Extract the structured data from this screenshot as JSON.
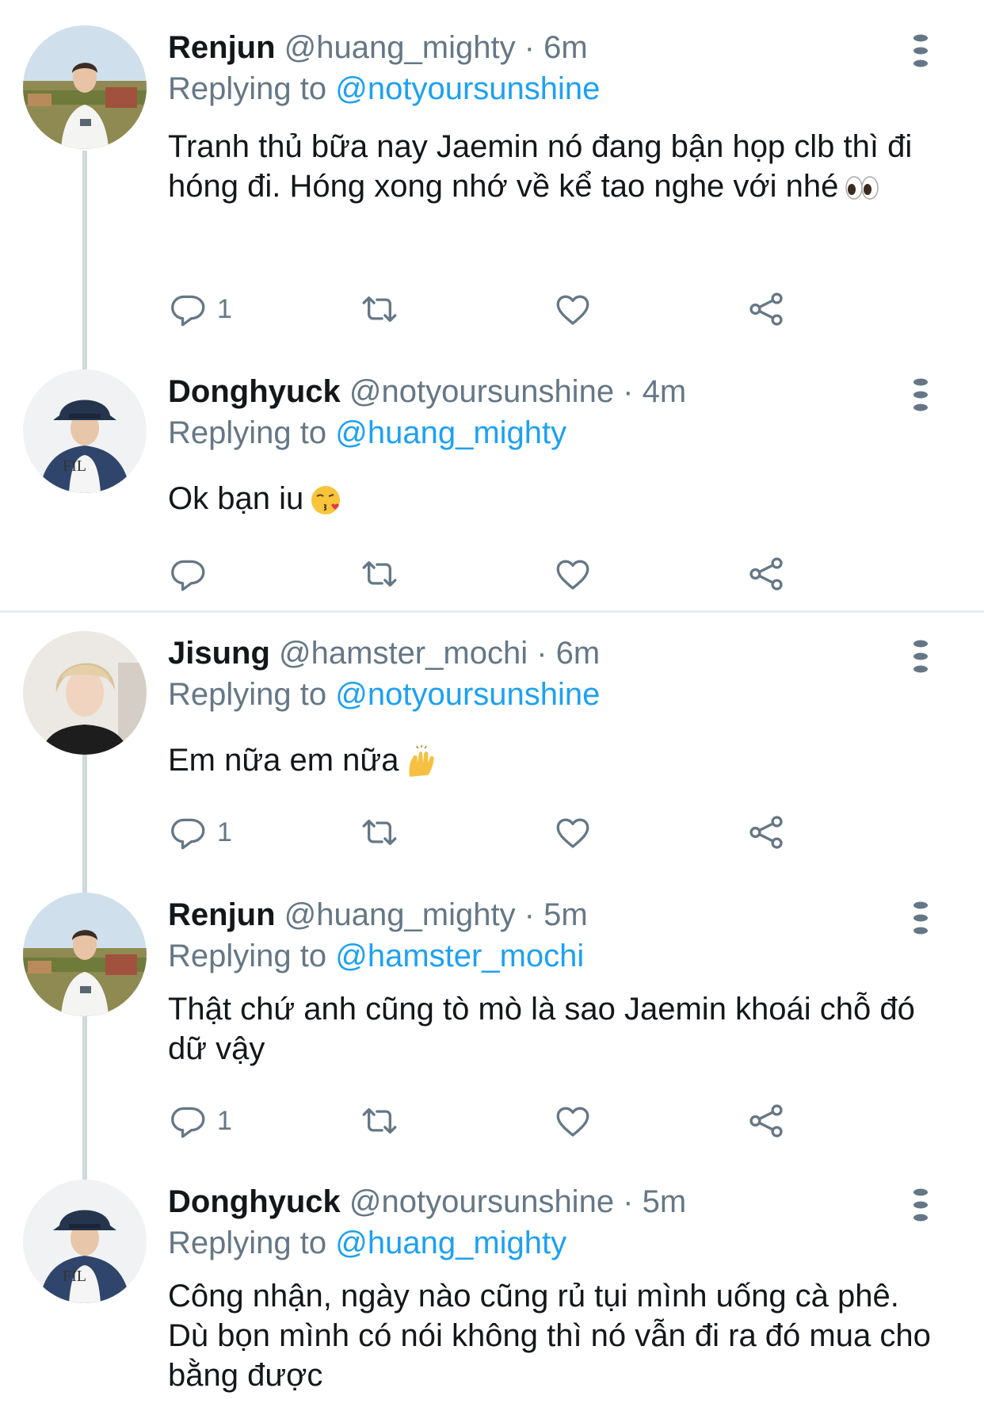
{
  "tweets": [
    {
      "name": "Renjun",
      "meta": "@huang_mighty · 6m",
      "replying_prefix": "Replying to",
      "mention": "@notyoursunshine",
      "body": "Tranh thủ bữa nay Jaemin nó đang bận họp clb thì đi hóng đi. Hóng xong nhớ về kể tao nghe với nhé",
      "emoji": "eyes-emoji",
      "reply_count": "1"
    },
    {
      "name": "Donghyuck",
      "meta": "@notyoursunshine · 4m",
      "replying_prefix": "Replying to",
      "mention": "@huang_mighty",
      "body": "Ok bạn iu",
      "emoji": "kissing-face-emoji",
      "reply_count": ""
    },
    {
      "name": "Jisung",
      "meta": "@hamster_mochi · 6m",
      "replying_prefix": "Replying to",
      "mention": "@notyoursunshine",
      "body": "Em nữa em nữa",
      "emoji": "raising-hands-emoji",
      "reply_count": "1"
    },
    {
      "name": "Renjun",
      "meta": "@huang_mighty · 5m",
      "replying_prefix": "Replying to",
      "mention": "@hamster_mochi",
      "body": "Thật chứ anh cũng tò mò là sao Jaemin khoái chỗ đó dữ vậy",
      "emoji": "",
      "reply_count": "1"
    },
    {
      "name": "Donghyuck",
      "meta": "@notyoursunshine · 5m",
      "replying_prefix": "Replying to",
      "mention": "@huang_mighty",
      "body": "Công nhận, ngày nào cũng rủ tụi mình uống cà phê. Dù bọn mình có nói không thì nó vẫn đi ra đó mua cho bằng được",
      "emoji": "",
      "reply_count": ""
    }
  ],
  "icons": {
    "reply": "reply-icon",
    "retweet": "retweet-icon",
    "like": "heart-icon",
    "share": "share-icon",
    "more": "more-options-icon"
  },
  "colors": {
    "name": "#14171a",
    "meta": "#657786",
    "mention": "#1da1f2",
    "divider": "#e6ecf0",
    "thread_line": "#cfd9de"
  }
}
